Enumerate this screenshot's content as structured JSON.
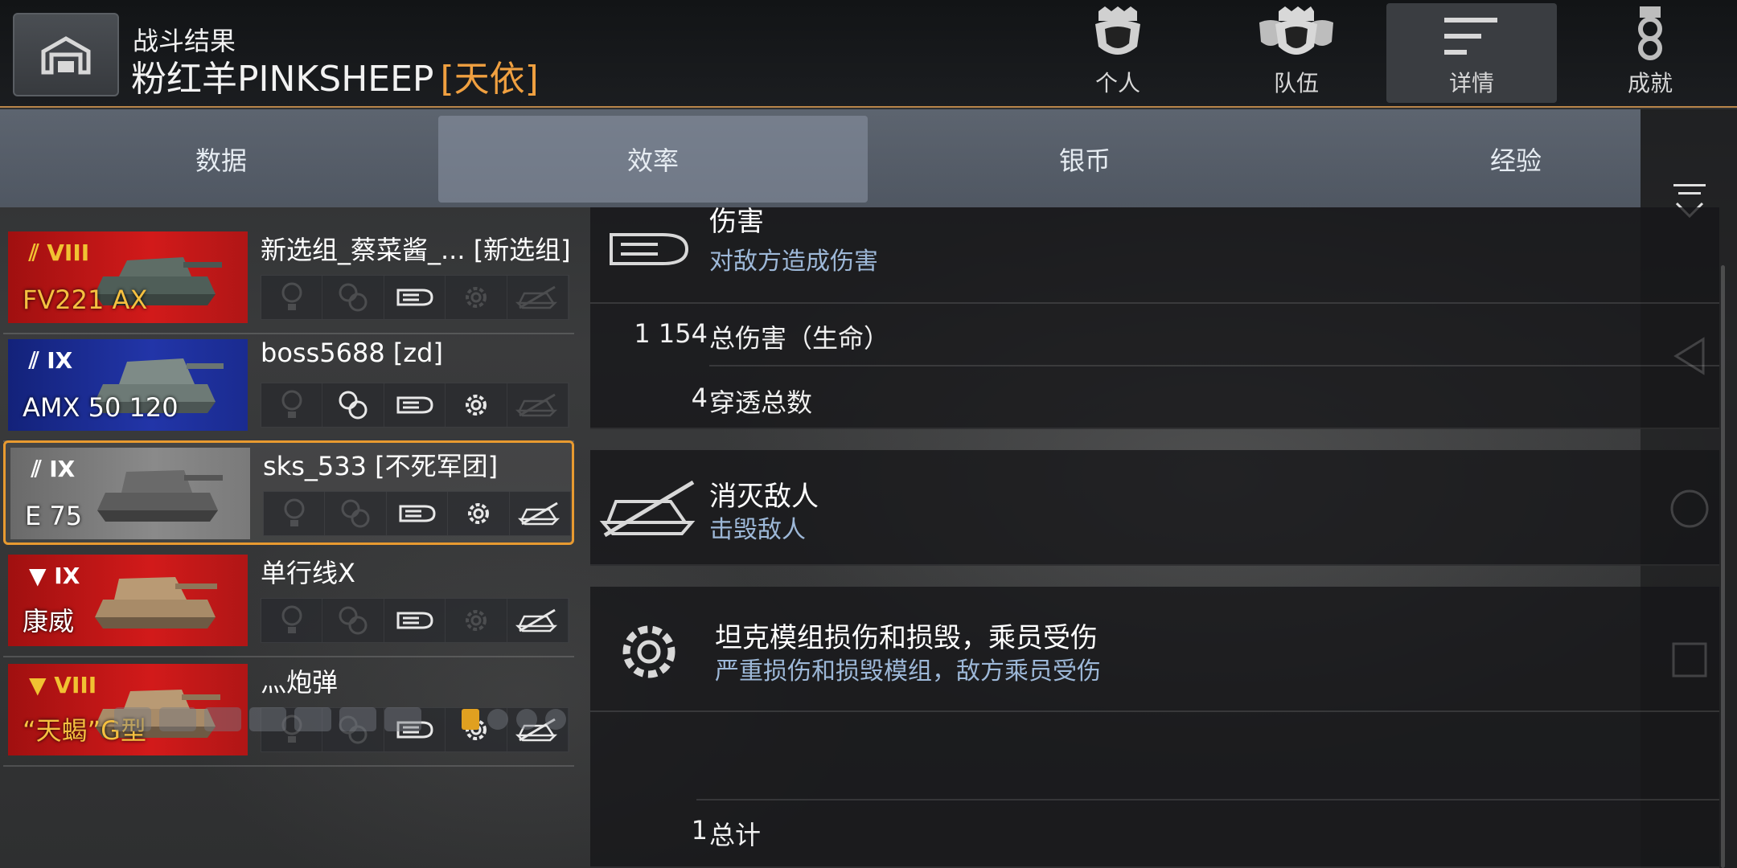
{
  "header": {
    "title": "战斗结果",
    "player_name": "粉红羊PINKSHEEP",
    "player_clan": "[天依]"
  },
  "top_tabs": [
    {
      "label": "个人",
      "icon": "helmet-icon"
    },
    {
      "label": "队伍",
      "icon": "team-helmets-icon"
    },
    {
      "label": "详情",
      "icon": "details-lines-icon",
      "active": true
    },
    {
      "label": "成就",
      "icon": "medal-icon"
    }
  ],
  "sub_tabs": [
    {
      "label": "数据"
    },
    {
      "label": "效率",
      "active": true
    },
    {
      "label": "银币"
    },
    {
      "label": "经验"
    }
  ],
  "players": [
    {
      "name": "新选组_蔡菜酱_... [新选组]",
      "tier": "VIII",
      "tank": "FV221 AX",
      "tank_gold": true,
      "card": "red",
      "selected": false
    },
    {
      "name": "boss5688 [zd]",
      "tier": "IX",
      "tank": "AMX 50 120",
      "tank_gold": false,
      "card": "blue",
      "selected": false
    },
    {
      "name": "sks_533 [不死军团]",
      "tier": "IX",
      "tank": "E 75",
      "tank_gold": false,
      "card": "grey",
      "selected": true
    },
    {
      "name": "单行线X",
      "tier": "IX",
      "tank": "康威",
      "tank_gold": false,
      "card": "red",
      "selected": false
    },
    {
      "name": "灬炮弹",
      "tier": "VIII",
      "tank": "“天蝎”G型",
      "tank_gold": true,
      "card": "red",
      "selected": false
    }
  ],
  "panels": {
    "damage": {
      "title": "伤害",
      "subtitle": "对敌方造成伤害",
      "stats": [
        {
          "value": "1 154",
          "label": "总伤害（生命）"
        },
        {
          "value": "4",
          "label": "穿透总数"
        }
      ]
    },
    "kills": {
      "title": "消灭敌人",
      "subtitle": "击毁敌人"
    },
    "modules": {
      "title": "坦克模组损伤和损毁，乘员受伤",
      "subtitle": "严重损伤和损毁模组，敌方乘员受伤",
      "stats": [
        {
          "value": "1",
          "label": "总计"
        }
      ]
    }
  },
  "colors": {
    "accent": "#e89a30",
    "clan": "#f0a040",
    "subtitle": "#9db8d8",
    "team_red": "#c41818",
    "team_blue": "#2235a8"
  }
}
